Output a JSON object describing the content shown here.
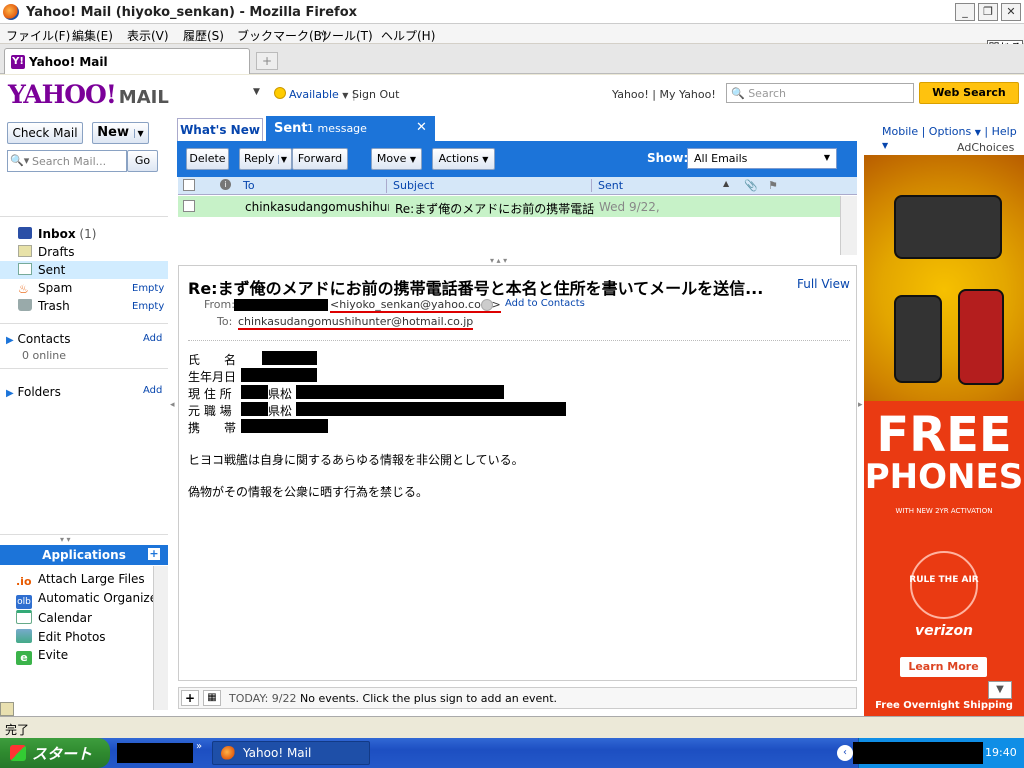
{
  "window": {
    "title": "Yahoo! Mail (hiyoko_senkan) - Mozilla Firefox"
  },
  "menu": [
    "ファイル(F)",
    "編集(E)",
    "表示(V)",
    "履歴(S)",
    "ブックマーク(B)",
    "ツール(T)",
    "ヘルプ(H)"
  ],
  "browser_tab": {
    "label": "Yahoo! Mail",
    "close_label": "閉じる",
    "newtab_label": "+"
  },
  "header": {
    "logo": "YAHOO!",
    "logo_suffix": "MAIL",
    "status": "Available",
    "signout": "Sign Out",
    "links": "Yahoo! | My Yahoo!",
    "search_placeholder": "Search",
    "web_search": "Web Search"
  },
  "left": {
    "check_mail": "Check Mail",
    "new": "New",
    "search_placeholder": "Search Mail...",
    "go": "Go",
    "folders": [
      {
        "label": "Inbox",
        "count": "(1)"
      },
      {
        "label": "Drafts"
      },
      {
        "label": "Sent"
      },
      {
        "label": "Spam",
        "action": "Empty"
      },
      {
        "label": "Trash",
        "action": "Empty"
      }
    ],
    "contacts": "Contacts",
    "contacts_add": "Add",
    "online": "0 online",
    "folders_section": "Folders",
    "folders_add": "Add"
  },
  "applications": {
    "title": "Applications",
    "items": [
      {
        "icon": ".io",
        "label": "Attach Large Files"
      },
      {
        "icon": "olb",
        "label": "Automatic Organizer"
      },
      {
        "icon": "calendar-icon",
        "label": "Calendar"
      },
      {
        "icon": "photo-icon",
        "label": "Edit Photos"
      },
      {
        "icon": "e",
        "label": "Evite"
      }
    ]
  },
  "tabs": {
    "whats_new": "What's New",
    "sent": "Sent",
    "sent_count": "1 message",
    "close": "✕"
  },
  "toolbar": {
    "delete": "Delete",
    "reply": "Reply",
    "forward": "Forward",
    "move": "Move",
    "actions": "Actions",
    "show_label": "Show:",
    "show_value": "All Emails"
  },
  "grid": {
    "headers": {
      "to": "To",
      "subject": "Subject",
      "sent": "Sent"
    },
    "rows": [
      {
        "to": "chinkasudangomushihunt",
        "subject": "Re:まず俺のメアドにお前の携帯電話番",
        "sent": "Wed 9/22,"
      }
    ]
  },
  "message": {
    "subject": "Re:まず俺のメアドにお前の携帯電話番号と本名と住所を書いてメールを送信...",
    "full_view": "Full View",
    "from_label": "From:",
    "from_email": "<hiyoko_senkan@yahoo.com>",
    "add_contacts": "Add to Contacts",
    "to_label": "To:",
    "to_email": "chinkasudangomushihunter@hotmail.co.jp",
    "fields": [
      "氏　　名",
      "生年月日",
      "現 住 所",
      "元 職 場",
      "携　　帯"
    ],
    "field_texts": [
      "",
      "",
      "県松",
      "県松",
      ""
    ],
    "line1": "ヒヨコ戦艦は自身に関するあらゆる情報を非公開としている。",
    "line2": "偽物がその情報を公衆に晒す行為を禁じる。"
  },
  "calendar": {
    "today": "TODAY: 9/22",
    "text": "No events. Click the plus sign to add an event."
  },
  "right_links": {
    "mobile": "Mobile",
    "options": "Options",
    "help": "Help",
    "adchoices": "AdChoices"
  },
  "ad": {
    "headline1": "FREE",
    "headline2": "PHONES",
    "sub": "WITH NEW 2YR ACTIVATION",
    "rule": "RULE THE AIR",
    "brand": "verizon",
    "cta": "Learn More",
    "footer": "Free Overnight Shipping"
  },
  "statusbar": {
    "text": "完了"
  },
  "taskbar": {
    "start": "スタート",
    "item": "Yahoo! Mail",
    "clock": "19:40"
  },
  "colors": {
    "yahoo_purple": "#7b0099",
    "blue": "#1c74d9",
    "selected_row": "#c7f2c8",
    "ad_red": "#ea3a12"
  }
}
